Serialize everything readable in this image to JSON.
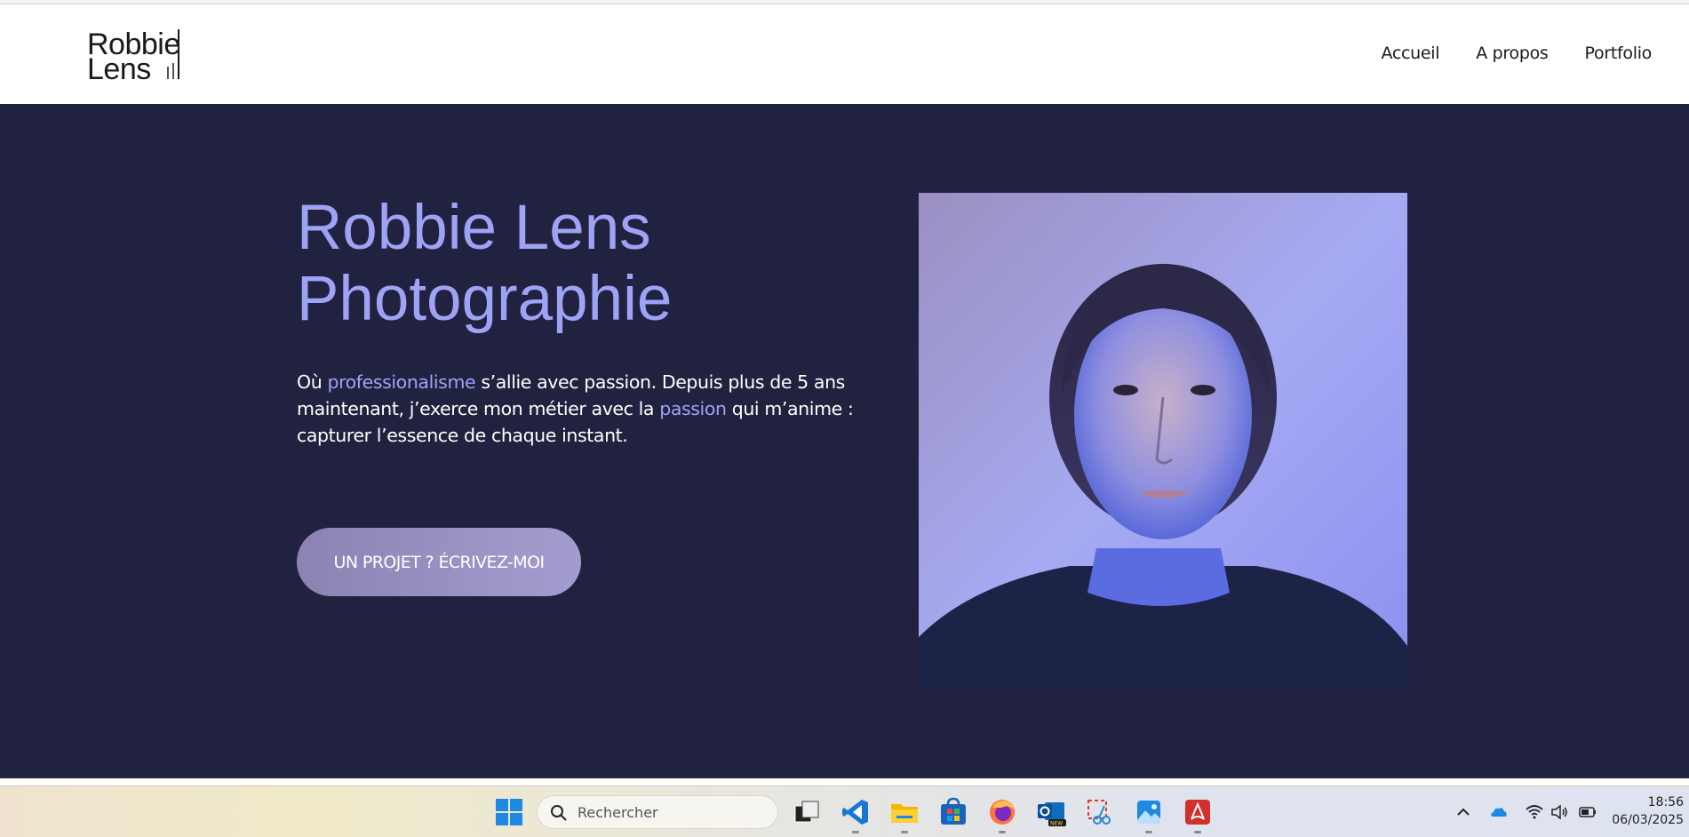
{
  "brand": {
    "line1": "Robbie",
    "line2": "Lens"
  },
  "nav": {
    "items": [
      "Accueil",
      "A propos",
      "Portfolio"
    ]
  },
  "hero": {
    "title_line1": "Robbie Lens",
    "title_line2": "Photographie",
    "intro": {
      "p1": "Où ",
      "hl1": "professionalisme",
      "p2": " s’allie avec passion. Depuis plus de 5 ans maintenant, j’exerce mon métier avec la ",
      "hl2": "passion",
      "p3": " qui m’anime : capturer l’essence de chaque instant."
    },
    "cta_label": "UN PROJET ? ÉCRIVEZ-MOI",
    "portrait_icon": "portrait-photo"
  },
  "colors": {
    "hero_bg": "#21223f",
    "accent": "#9ea3f5",
    "cta_bg": "#978fc2"
  },
  "taskbar": {
    "search_placeholder": "Rechercher",
    "apps": [
      "windows-start-icon",
      "task-view-icon",
      "vscode-icon",
      "file-explorer-icon",
      "store-icon",
      "firefox-icon",
      "outlook-new-icon",
      "snipping-tool-icon",
      "photos-icon",
      "acrobat-icon"
    ],
    "tray": [
      "chevron-up-icon",
      "onedrive-icon",
      "wifi-icon",
      "volume-icon",
      "battery-icon"
    ],
    "time": "18:56",
    "date": "06/03/2025"
  }
}
